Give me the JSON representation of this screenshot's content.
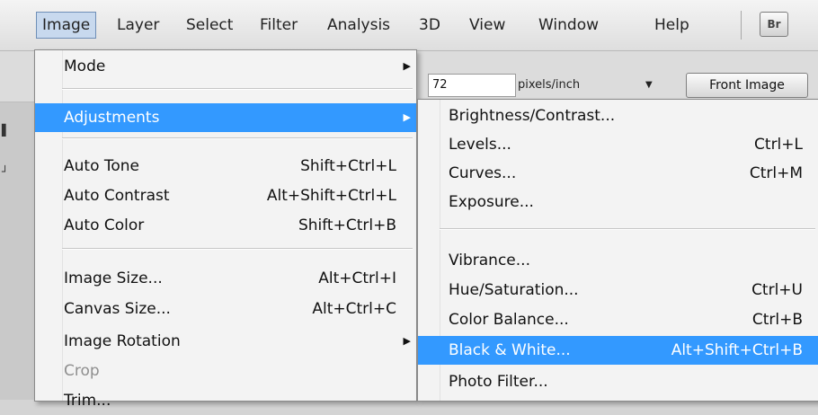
{
  "menubar": {
    "items": [
      "Image",
      "Layer",
      "Select",
      "Filter",
      "Analysis",
      "3D",
      "View",
      "Window",
      "Help"
    ],
    "bridge_label": "Br"
  },
  "options": {
    "resolution_value": "72",
    "units": "pixels/inch",
    "front_image_label": "Front Image"
  },
  "image_menu": {
    "mode": "Mode",
    "adjustments": "Adjustments",
    "auto_tone": {
      "label": "Auto Tone",
      "shortcut": "Shift+Ctrl+L"
    },
    "auto_contrast": {
      "label": "Auto Contrast",
      "shortcut": "Alt+Shift+Ctrl+L"
    },
    "auto_color": {
      "label": "Auto Color",
      "shortcut": "Shift+Ctrl+B"
    },
    "image_size": {
      "label": "Image Size...",
      "shortcut": "Alt+Ctrl+I"
    },
    "canvas_size": {
      "label": "Canvas Size...",
      "shortcut": "Alt+Ctrl+C"
    },
    "image_rotation": "Image Rotation",
    "crop": "Crop",
    "trim": "Trim..."
  },
  "adjustments_menu": {
    "brightness_contrast": {
      "label": "Brightness/Contrast...",
      "shortcut": ""
    },
    "levels": {
      "label": "Levels...",
      "shortcut": "Ctrl+L"
    },
    "curves": {
      "label": "Curves...",
      "shortcut": "Ctrl+M"
    },
    "exposure": {
      "label": "Exposure...",
      "shortcut": ""
    },
    "vibrance": {
      "label": "Vibrance...",
      "shortcut": ""
    },
    "hue_saturation": {
      "label": "Hue/Saturation...",
      "shortcut": "Ctrl+U"
    },
    "color_balance": {
      "label": "Color Balance...",
      "shortcut": "Ctrl+B"
    },
    "black_white": {
      "label": "Black & White...",
      "shortcut": "Alt+Shift+Ctrl+B"
    },
    "photo_filter": {
      "label": "Photo Filter...",
      "shortcut": ""
    }
  },
  "colors": {
    "highlight": "#3399ff",
    "menu_bg": "#f3f3f3",
    "menubar_active": "#c8d9ee"
  }
}
